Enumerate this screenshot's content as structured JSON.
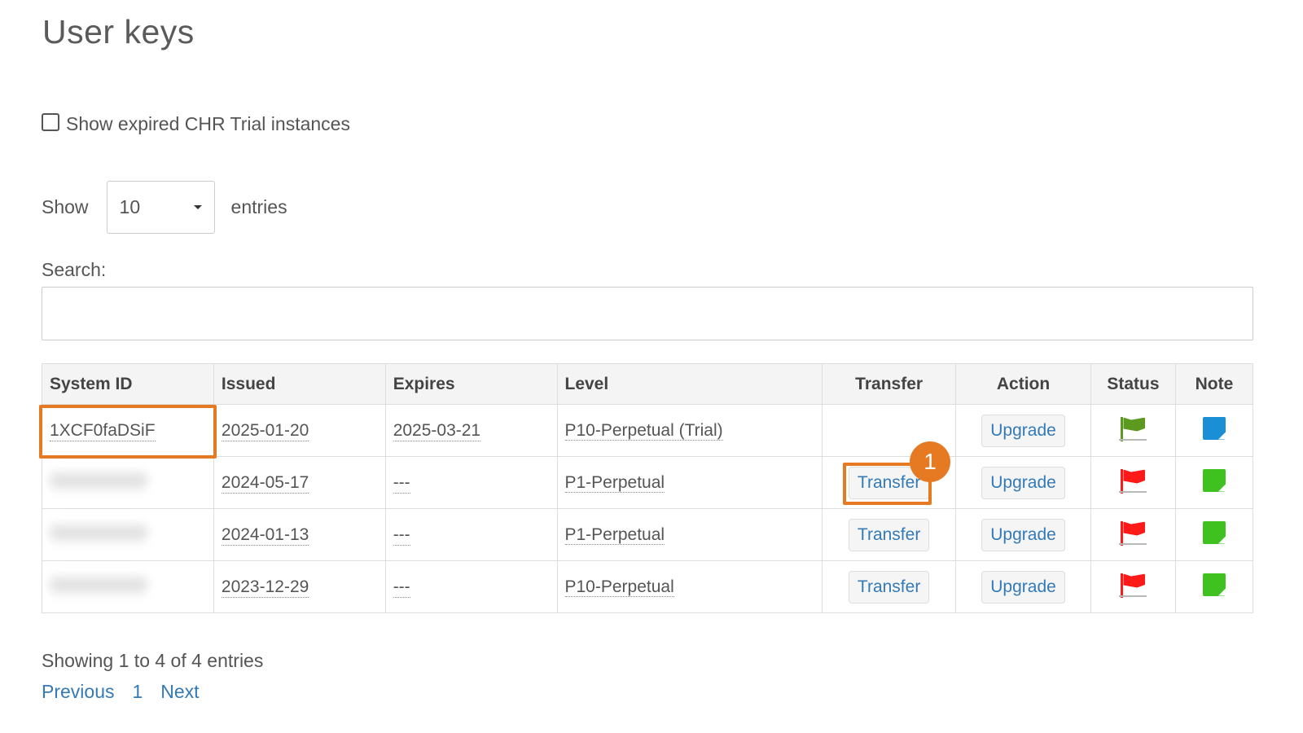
{
  "title": "User keys",
  "show_expired_label": "Show expired CHR Trial instances",
  "length": {
    "prefix": "Show",
    "value": "10",
    "suffix": "entries"
  },
  "search": {
    "label": "Search:",
    "value": ""
  },
  "table": {
    "headers": [
      "System ID",
      "Issued",
      "Expires",
      "Level",
      "Transfer",
      "Action",
      "Status",
      "Note"
    ],
    "rows": [
      {
        "system_id": "1XCF0faDSiF",
        "issued": "2025-01-20",
        "expires": "2025-03-21",
        "level": "P10-Perpetual (Trial)",
        "transfer": "",
        "action": "Upgrade",
        "status": "green-flag-icon",
        "note": "blue-note-icon"
      },
      {
        "system_id": "",
        "issued": "2024-05-17",
        "expires": "---",
        "level": "P1-Perpetual",
        "transfer": "Transfer",
        "action": "Upgrade",
        "status": "red-flag-icon",
        "note": "green-note-icon"
      },
      {
        "system_id": "",
        "issued": "2024-01-13",
        "expires": "---",
        "level": "P1-Perpetual",
        "transfer": "Transfer",
        "action": "Upgrade",
        "status": "red-flag-icon",
        "note": "green-note-icon"
      },
      {
        "system_id": "",
        "issued": "2023-12-29",
        "expires": "---",
        "level": "P10-Perpetual",
        "transfer": "Transfer",
        "action": "Upgrade",
        "status": "red-flag-icon",
        "note": "green-note-icon"
      }
    ]
  },
  "info": "Showing 1 to 4 of 4 entries",
  "pagination": {
    "previous": "Previous",
    "current": "1",
    "next": "Next"
  },
  "annotation": {
    "badge": "1"
  },
  "colors": {
    "link": "#337ab7",
    "highlight": "#e67a22",
    "flag_green": "#5b9a1f",
    "flag_red": "#ff1a1a",
    "note_blue": "#1a8fd6",
    "note_green": "#3fc21f"
  }
}
